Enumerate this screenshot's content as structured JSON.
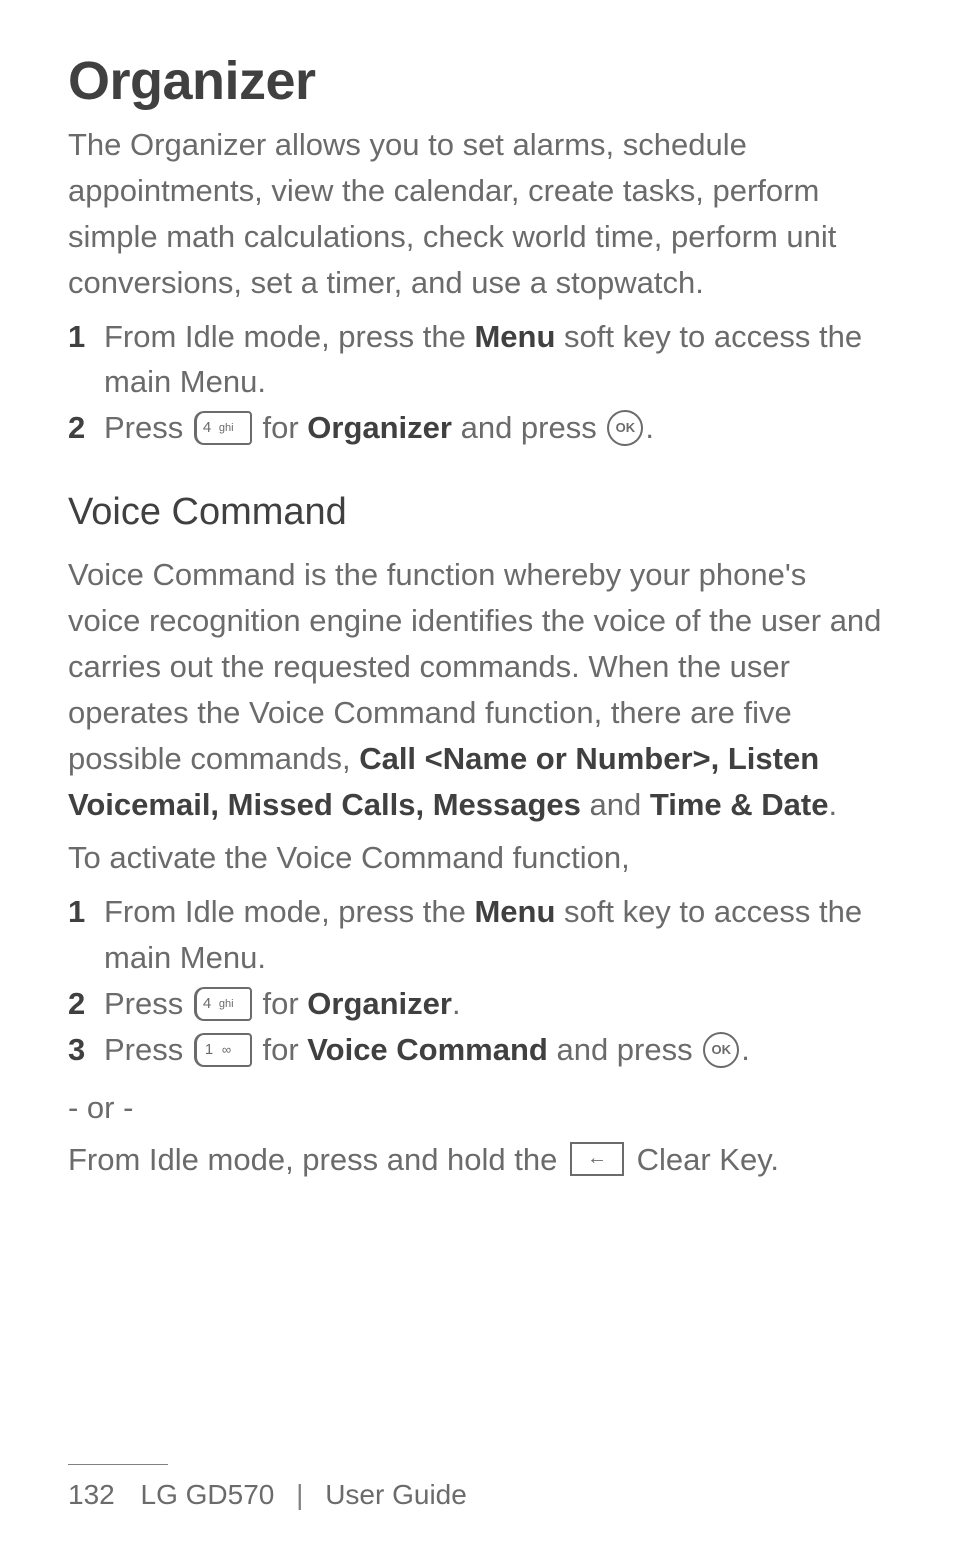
{
  "title": "Organizer",
  "intro": "The Organizer allows you to set alarms, schedule appointments, view the calendar, create tasks, perform simple math calculations, check world time, perform unit conversions, set a timer, and use a stopwatch.",
  "steps_intro": [
    {
      "num": "1",
      "prefix": "From Idle mode, press the ",
      "bold": "Menu",
      "suffix": " soft key to access the main Menu."
    },
    {
      "num": "2",
      "prefix": "Press ",
      "key1": "4ghi",
      "mid1": " for ",
      "bold": "Organizer",
      "mid2": " and press ",
      "key2": "ok",
      "suffix": "."
    }
  ],
  "section_title": "Voice Command",
  "vc_body_prefix": "Voice Command is the function whereby your phone's voice recognition engine identifies the voice of the user and carries out the requested commands. When the user operates the Voice Command function, there are five possible commands, ",
  "vc_bold1": "Call <Name or Number>, Listen Voicemail, Missed Calls, Messages",
  "vc_mid": " and ",
  "vc_bold2": "Time & Date",
  "vc_suffix": ".",
  "vc_activate": "To activate the Voice Command function,",
  "vc_steps": [
    {
      "num": "1",
      "prefix": "From Idle mode, press the ",
      "bold": "Menu",
      "suffix": " soft key to access the main Menu."
    },
    {
      "num": "2",
      "prefix": "Press ",
      "key1": "4ghi",
      "mid1": " for ",
      "bold": "Organizer",
      "suffix": "."
    },
    {
      "num": "3",
      "prefix": "Press ",
      "key1": "1",
      "mid1": " for ",
      "bold": "Voice Command",
      "mid2": " and press ",
      "key2": "ok",
      "suffix": "."
    }
  ],
  "or_text": "- or -",
  "idle_prefix": "From Idle mode, press and hold the ",
  "idle_suffix": " Clear Key.",
  "footer": {
    "page": "132",
    "product": "LG GD570",
    "guide": "User Guide"
  }
}
